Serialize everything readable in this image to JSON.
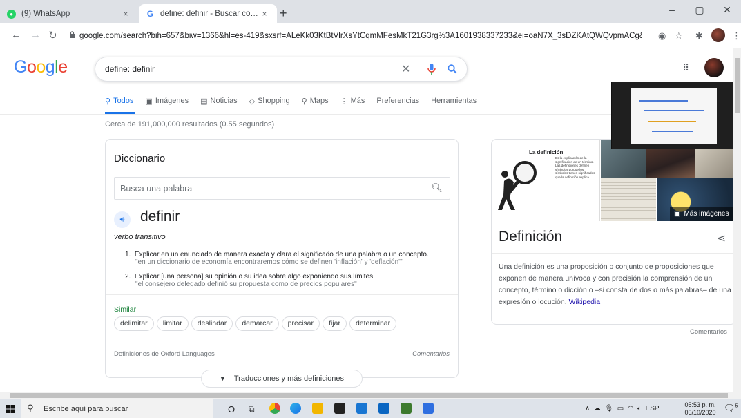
{
  "browser": {
    "tabs": [
      {
        "title": "(9) WhatsApp",
        "close": "×"
      },
      {
        "title": "define: definir - Buscar con Goog",
        "close": "×"
      }
    ],
    "new_tab": "+",
    "url": "google.com/search?bih=657&biw=1366&hl=es-419&sxsrf=ALeKk03KtBtVlrXsYtCqmMFesMkT21G3rg%3A1601938337233&ei=oaN7X_3sDZKAtQWQvpmACg&q=def...",
    "window_controls": [
      "–",
      "▢",
      "✕"
    ]
  },
  "google": {
    "logo": "Google",
    "query": "define: definir",
    "tabs": [
      {
        "label": "Todos",
        "icon": "search-icon",
        "selected": true
      },
      {
        "label": "Imágenes",
        "icon": "image-icon"
      },
      {
        "label": "Noticias",
        "icon": "news-icon"
      },
      {
        "label": "Shopping",
        "icon": "tag-icon"
      },
      {
        "label": "Maps",
        "icon": "map-pin-icon"
      },
      {
        "label": "Más",
        "icon": "more-vert-icon"
      },
      {
        "label": "Preferencias"
      },
      {
        "label": "Herramientas"
      }
    ],
    "stats": "Cerca de 191,000,000 resultados (0.55 segundos)"
  },
  "dictionary": {
    "title": "Diccionario",
    "search_placeholder": "Busca una palabra",
    "word": "definir",
    "pos": "verbo transitivo",
    "definitions": [
      {
        "n": "1.",
        "text": "Explicar en un enunciado de manera exacta y clara el significado de una palabra o un concepto.",
        "example": "\"en un diccionario de economía encontraremos cómo se definen 'inflación' y 'deflación'\""
      },
      {
        "n": "2.",
        "text": "Explicar [una persona] su opinión o su idea sobre algo exponiendo sus límites.",
        "example": "\"el consejero delegado definió su propuesta como de precios populares\""
      }
    ],
    "similar_label": "Similar",
    "similar": [
      "delimitar",
      "limitar",
      "deslindar",
      "demarcar",
      "precisar",
      "fijar",
      "determinar"
    ],
    "source": "Definiciones de Oxford Languages",
    "comments": "Comentarios",
    "more_button": "Traducciones y más definiciones"
  },
  "knowledge_panel": {
    "img_title": "La definición",
    "img_caption": "Es la explicación de la significación de un término. Las definiciones definen símbolos porque los símbolos tienen significados que la definición explica.",
    "more_images": "Más imágenes",
    "title": "Definición",
    "description": "Una definición es una proposición o conjunto de proposiciones que exponen de manera unívoca y con precisión la comprensión de un concepto, término o dicción o –si consta de dos o más palabras– de una expresión o locución.",
    "source_link": "Wikipedia",
    "comments": "Comentarios"
  },
  "taskbar": {
    "search_text": "Escribe aquí para buscar",
    "language": "ESP",
    "time": "05:53 p. m.",
    "date": "05/10/2020",
    "notifications": "5"
  },
  "colors": {
    "google_blue": "#4285f4",
    "google_red": "#ea4335",
    "google_yellow": "#fbbc05",
    "google_green": "#34a853",
    "link": "#1a0dab",
    "similar_green": "#188038"
  }
}
